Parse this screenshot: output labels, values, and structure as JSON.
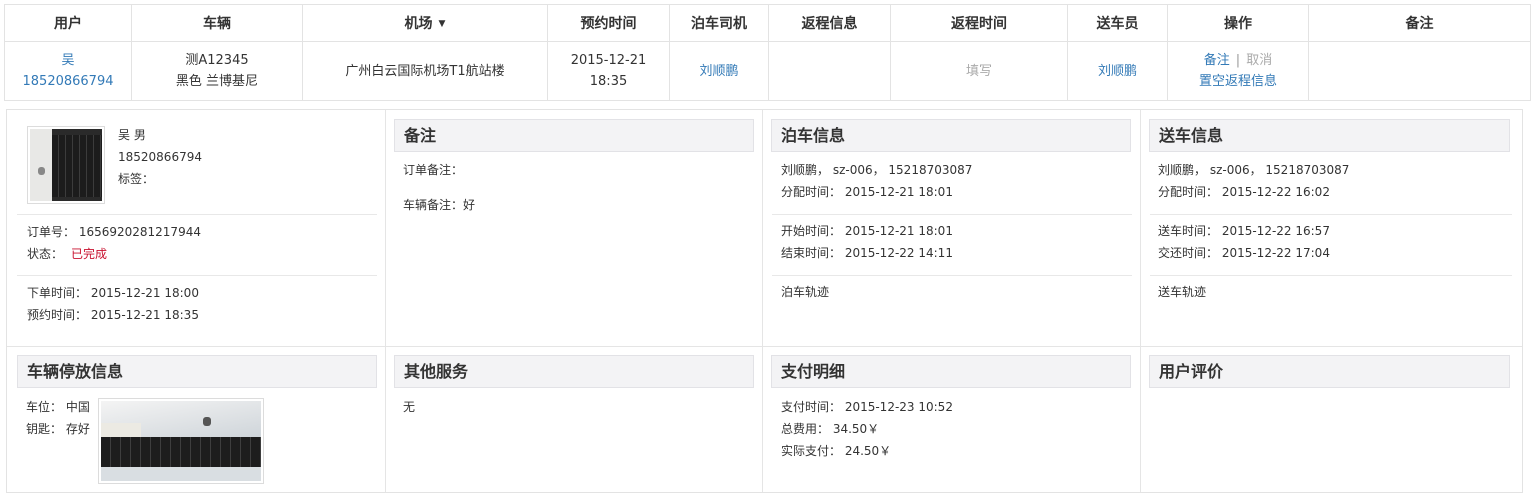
{
  "table": {
    "headers": {
      "user": "用户",
      "vehicle": "车辆",
      "airport": "机场",
      "airport_caret": "▼",
      "reserve_time": "预约时间",
      "parking_driver": "泊车司机",
      "return_info": "返程信息",
      "return_time": "返程时间",
      "delivery": "送车员",
      "action": "操作",
      "remark": "备注"
    },
    "row": {
      "user_name": "吴",
      "user_phone": "18520866794",
      "plate": "测A12345",
      "car": "黑色 兰博基尼",
      "airport": "广州白云国际机场T1航站楼",
      "reserve_date": "2015-12-21",
      "reserve_clock": "18:35",
      "parking_driver": "刘顺鹏",
      "return_info": "",
      "return_time": "填写",
      "delivery": "刘顺鹏",
      "action_remark": "备注",
      "action_sep": "|",
      "action_cancel": "取消",
      "action_clear": "置空返程信息",
      "remark": ""
    }
  },
  "detail": {
    "customer": {
      "name_gender": "吴 男",
      "phone": "18520866794",
      "tag_label": "标签：",
      "order_no": "订单号：  1656920281217944",
      "status_label": "状态：",
      "status_value": "已完成",
      "order_time": "下单时间：  2015-12-21 18:00",
      "reserve_time": "预约时间：  2015-12-21 18:35"
    },
    "remarks": {
      "title": "备注",
      "order_note": "订单备注：",
      "vehicle_note": "车辆备注：好"
    },
    "parking": {
      "title": "泊车信息",
      "driver_line": "刘顺鹏，  sz-006，  15218703087",
      "assign_time": "分配时间：  2015-12-21 18:01",
      "start_time": "开始时间：  2015-12-21 18:01",
      "end_time": "结束时间：  2015-12-22 14:11",
      "track_link": "泊车轨迹"
    },
    "delivery": {
      "title": "送车信息",
      "driver_line": "刘顺鹏，  sz-006，  15218703087",
      "assign_time": "分配时间：  2015-12-22 16:02",
      "deliver_time": "送车时间：  2015-12-22 16:57",
      "handover_time": "交还时间：  2015-12-22 17:04",
      "track_link": "送车轨迹"
    },
    "storage": {
      "title": "车辆停放信息",
      "spot": "车位：  中国",
      "key": "钥匙：  存好"
    },
    "other_services": {
      "title": "其他服务",
      "value": "无"
    },
    "payment": {
      "title": "支付明细",
      "pay_time": "支付时间：  2015-12-23 10:52",
      "total": "总费用：  34.50￥",
      "actual": "实际支付：  24.50￥"
    },
    "review": {
      "title": "用户评价"
    }
  },
  "colors": {
    "link": "#337ab7",
    "status_done": "#c8102e",
    "panel_header_bg": "#f3f3f5"
  }
}
